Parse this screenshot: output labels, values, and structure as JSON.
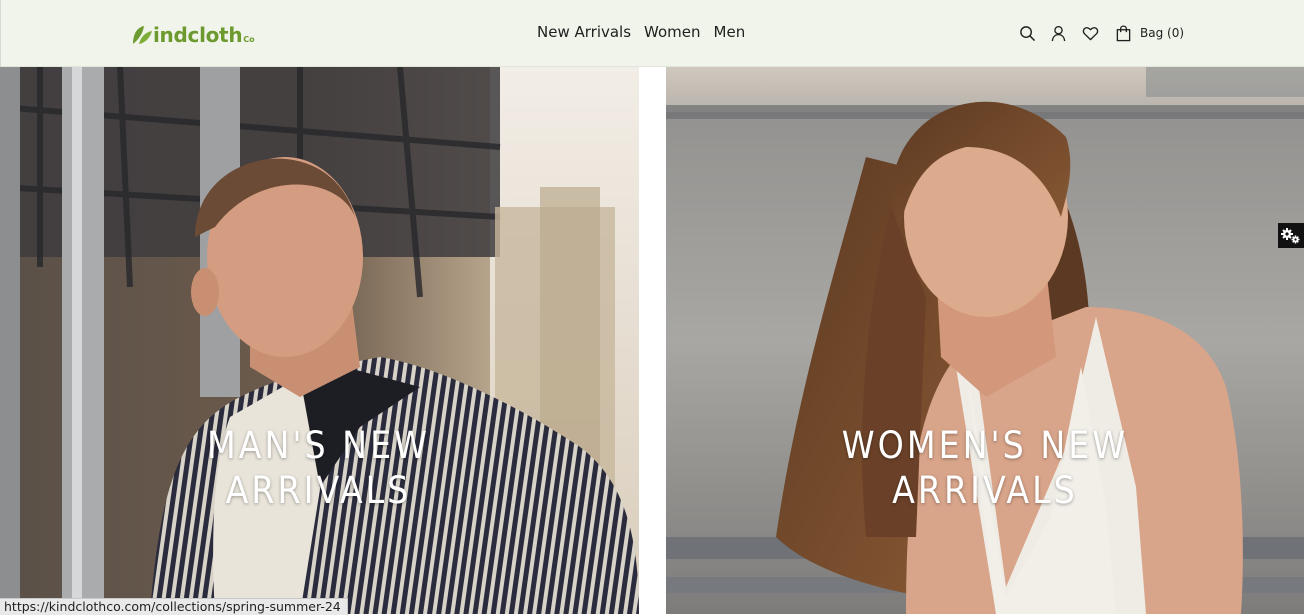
{
  "brand": {
    "name": "Kindcloth",
    "logo_text": "indcloth",
    "logo_suffix": "Co",
    "color": "#6d9a2e"
  },
  "nav": {
    "items": [
      {
        "label": "New Arrivals"
      },
      {
        "label": "Women"
      },
      {
        "label": "Men"
      }
    ]
  },
  "header_icons": [
    "search-icon",
    "user-icon",
    "heart-icon",
    "bag-icon"
  ],
  "bag": {
    "label": "Bag (0)"
  },
  "hero": {
    "men": {
      "line1": "MAN'S NEW",
      "line2": "ARRIVALS"
    },
    "women": {
      "line1": "WOMEN'S NEW",
      "line2": "ARRIVALS"
    }
  },
  "status_bar": {
    "url": "https://kindclothco.com/collections/spring-summer-24"
  },
  "colors": {
    "header_bg": "#f1f4ea",
    "text": "#1f1f1f"
  }
}
